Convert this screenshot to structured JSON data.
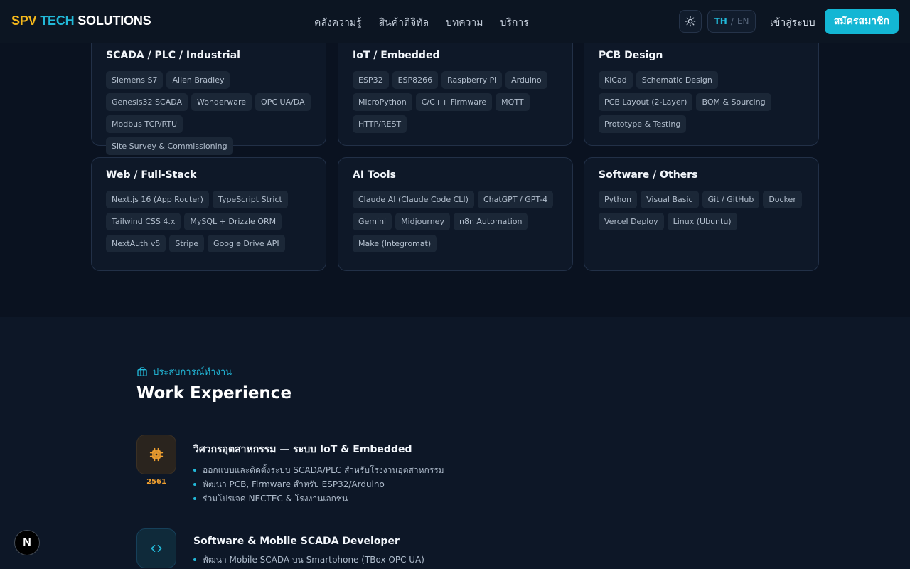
{
  "header": {
    "brand": {
      "part1": "SPV",
      "part2": "TECH",
      "part3": "SOLUTIONS"
    },
    "nav": [
      {
        "label": "คลังความรู้",
        "key": "knowledge"
      },
      {
        "label": "สินค้าดิจิทัล",
        "key": "digital-products"
      },
      {
        "label": "บทความ",
        "key": "articles"
      },
      {
        "label": "บริการ",
        "key": "services"
      }
    ],
    "theme_icon": "sun-icon",
    "lang": {
      "active": "TH",
      "separator": "/",
      "other": "EN"
    },
    "login_label": "เข้าสู่ระบบ",
    "signup_label": "สมัครสมาชิก"
  },
  "skills": [
    {
      "title": "SCADA / PLC / Industrial",
      "tags": [
        "Siemens S7",
        "Allen Bradley",
        "Genesis32 SCADA",
        "Wonderware",
        "OPC UA/DA",
        "Modbus TCP/RTU",
        "Site Survey & Commissioning"
      ]
    },
    {
      "title": "IoT / Embedded",
      "tags": [
        "ESP32",
        "ESP8266",
        "Raspberry Pi",
        "Arduino",
        "MicroPython",
        "C/C++ Firmware",
        "MQTT",
        "HTTP/REST"
      ]
    },
    {
      "title": "PCB Design",
      "tags": [
        "KiCad",
        "Schematic Design",
        "PCB Layout (2-Layer)",
        "BOM & Sourcing",
        "Prototype & Testing"
      ]
    },
    {
      "title": "Web / Full-Stack",
      "tags": [
        "Next.js 16 (App Router)",
        "TypeScript Strict",
        "Tailwind CSS 4.x",
        "MySQL + Drizzle ORM",
        "NextAuth v5",
        "Stripe",
        "Google Drive API"
      ]
    },
    {
      "title": "AI Tools",
      "tags": [
        "Claude AI (Claude Code CLI)",
        "ChatGPT / GPT-4",
        "Gemini",
        "Midjourney",
        "n8n Automation",
        "Make (Integromat)"
      ]
    },
    {
      "title": "Software / Others",
      "tags": [
        "Python",
        "Visual Basic",
        "Git / GitHub",
        "Docker",
        "Vercel Deploy",
        "Linux (Ubuntu)"
      ]
    }
  ],
  "experience": {
    "eyebrow_icon": "briefcase-icon",
    "eyebrow": "ประสบการณ์ทำงาน",
    "title": "Work Experience",
    "jobs": [
      {
        "icon": "chip-icon",
        "year": "2561",
        "title": "วิศวกรอุตสาหกรรม — ระบบ IoT & Embedded",
        "bullets": [
          "ออกแบบและติดตั้งระบบ SCADA/PLC สำหรับโรงงานอุตสาหกรรม",
          "พัฒนา PCB, Firmware สำหรับ ESP32/Arduino",
          "ร่วมโปรเจค NECTEC & โรงงานเอกชน"
        ]
      },
      {
        "icon": "code-icon",
        "year": "",
        "title": "Software & Mobile SCADA Developer",
        "bullets": [
          "พัฒนา Mobile SCADA บน Smartphone (TBox OPC UA)"
        ]
      }
    ]
  },
  "badge": "N",
  "colors": {
    "accent": "#22b8d8",
    "brand_yellow": "#f5b81c",
    "background": "#0a1220",
    "card": "#0e1828",
    "year": "#f0a030"
  }
}
